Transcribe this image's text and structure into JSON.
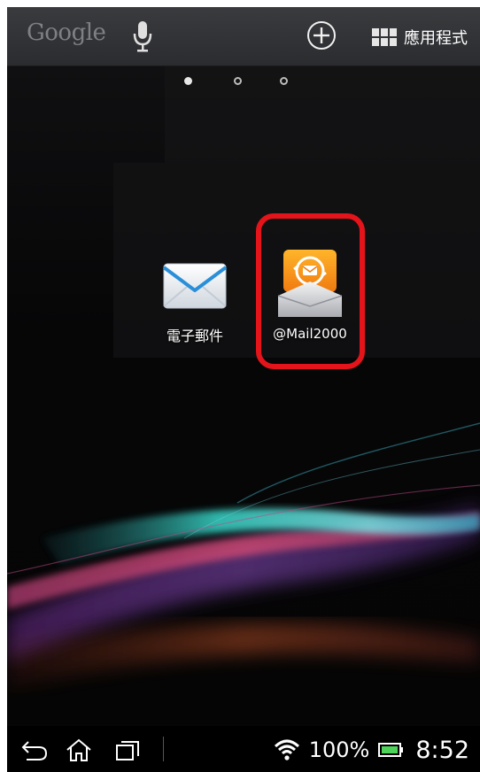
{
  "search_bar": {
    "google_logo": "Google",
    "apps_label": "應用程式"
  },
  "home_pages": {
    "count": 3,
    "active_index": 0
  },
  "apps": [
    {
      "label": "電子郵件",
      "icon": "email-envelope-icon"
    },
    {
      "label": "@Mail2000",
      "icon": "mail2000-app-icon"
    }
  ],
  "highlight": {
    "color": "#e4141a",
    "target": "@Mail2000"
  },
  "status_bar": {
    "battery_percent": "100%",
    "time": "8:52",
    "wifi_icon": "wifi-icon",
    "battery_icon": "battery-icon"
  },
  "nav_bar": {
    "back_icon": "back-icon",
    "home_icon": "home-icon",
    "recents_icon": "recent-apps-icon"
  }
}
